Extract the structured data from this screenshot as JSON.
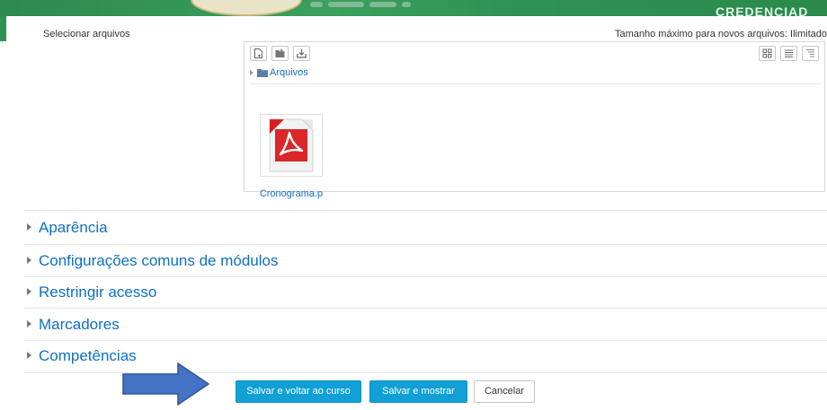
{
  "banner": {
    "right_text": "CREDENCIAD"
  },
  "filepicker": {
    "label": "Selecionar arquivos",
    "max_size_text": "Tamanho máximo para novos arquivos: Ilimitado",
    "path_label": "Arquivos",
    "file": {
      "name": "Cronograma.p",
      "icon": "pdf-icon"
    },
    "toolbar_icons": [
      "add-file-icon",
      "create-folder-icon",
      "download-icon"
    ],
    "view_icons": [
      "icon-view-icon",
      "list-view-icon",
      "tree-view-icon"
    ]
  },
  "sections": [
    {
      "label": "Aparência"
    },
    {
      "label": "Configurações comuns de módulos"
    },
    {
      "label": "Restringir acesso"
    },
    {
      "label": "Marcadores"
    },
    {
      "label": "Competências"
    }
  ],
  "buttons": {
    "save_return": "Salvar e voltar ao curso",
    "save_display": "Salvar e mostrar",
    "cancel": "Cancelar"
  },
  "colors": {
    "link": "#0f6fc5",
    "primary_button": "#10a0d6",
    "banner_green": "#2f9355",
    "arrow_blue": "#4472c4"
  }
}
